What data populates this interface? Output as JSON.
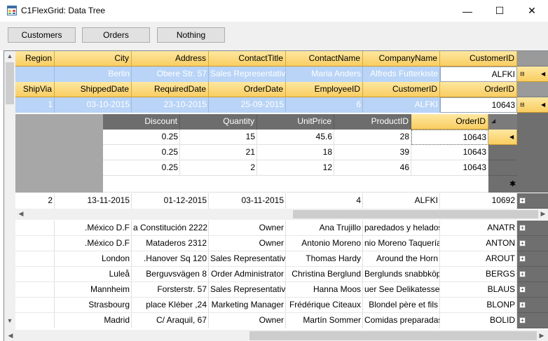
{
  "window": {
    "title": "C1FlexGrid: Data Tree",
    "minimize": "—",
    "maximize": "☐",
    "close": "✕"
  },
  "toolbar": {
    "customers_label": "Customers",
    "orders_label": "Orders",
    "nothing_label": "Nothing"
  },
  "customer_grid": {
    "headers": [
      "Region",
      "City",
      "Address",
      "ContactTitle",
      "ContactName",
      "CompanyName",
      "CustomerID"
    ],
    "selected_row": {
      "region": "",
      "city": "Berlin",
      "address": "Obere Str. 57",
      "contact_title": "Sales Representative",
      "contact_name": "Maria Anders",
      "company_name": "Alfreds Futterkiste",
      "customer_id": "ALFKI"
    },
    "rows": [
      [
        "",
        ".México D.F",
        "a Constitución 2222",
        "Owner",
        "Ana Trujillo",
        "paredados y helados",
        "ANATR"
      ],
      [
        "",
        ".México D.F",
        "Mataderos  2312",
        "Owner",
        "Antonio Moreno",
        "nio Moreno Taquería",
        "ANTON"
      ],
      [
        "",
        "London",
        ".Hanover Sq 120",
        "Sales Representative",
        "Thomas Hardy",
        "Around the Horn",
        "AROUT"
      ],
      [
        "",
        "Luleå",
        "Berguvsvägen  8",
        "Order Administrator",
        "Christina Berglund",
        "Berglunds snabbköp",
        "BERGS"
      ],
      [
        "",
        "Mannheim",
        "Forsterstr. 57",
        "Sales Representative",
        "Hanna Moos",
        "uer See Delikatessen",
        "BLAUS"
      ],
      [
        "",
        "Strasbourg",
        "place Kléber ,24",
        "Marketing Manager",
        "Frédérique Citeaux",
        "Blondel père et fils",
        "BLONP"
      ],
      [
        "",
        "Madrid",
        "C/ Araquil, 67",
        "Owner",
        "Martín Sommer",
        "Comidas preparadas",
        "BOLID"
      ]
    ]
  },
  "order_grid": {
    "headers": [
      "ShipVia",
      "ShippedDate",
      "RequiredDate",
      "OrderDate",
      "EmployeeID",
      "CustomerID",
      "OrderID"
    ],
    "selected_row": {
      "ship_via": "1",
      "shipped_date": "03-10-2015",
      "required_date": "23-10-2015",
      "order_date": "25-09-2015",
      "employee_id": "6",
      "customer_id": "ALFKI",
      "order_id": "10643"
    },
    "second_row": [
      "2",
      "13-11-2015",
      "01-12-2015",
      "03-11-2015",
      "4",
      "ALFKI",
      "10692"
    ]
  },
  "detail_grid": {
    "headers": [
      "Discount",
      "Quantity",
      "UnitPrice",
      "ProductID",
      "OrderID"
    ],
    "rows": [
      [
        "0.25",
        "15",
        "45.6",
        "28",
        "10643"
      ],
      [
        "0.25",
        "21",
        "18",
        "39",
        "10643"
      ],
      [
        "0.25",
        "2",
        "12",
        "46",
        "10643"
      ]
    ],
    "new_row_marker": "✱"
  }
}
